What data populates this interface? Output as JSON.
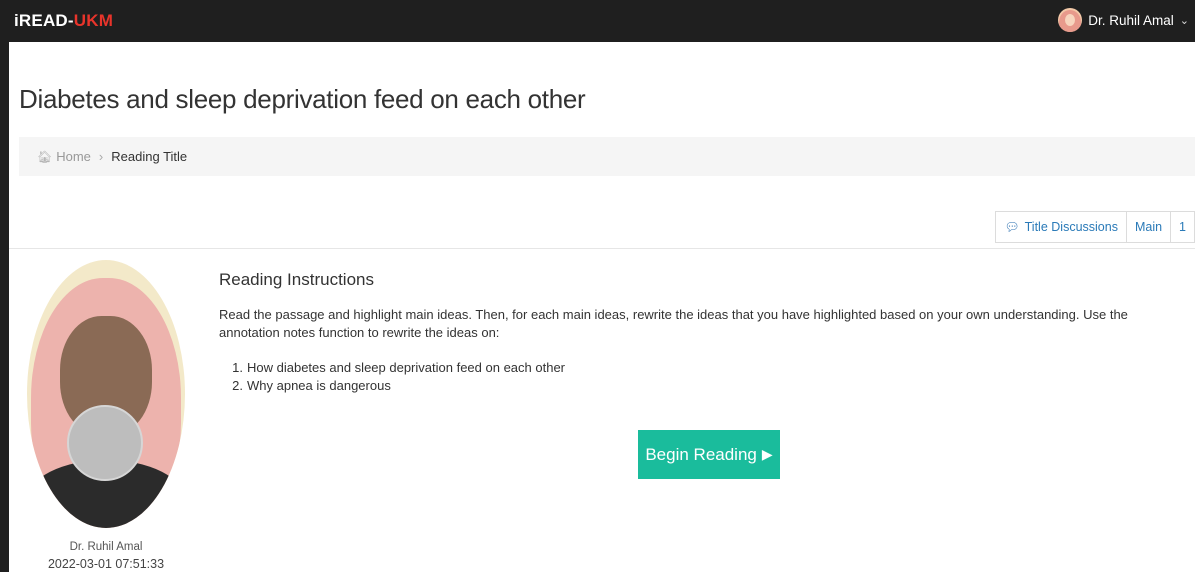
{
  "header": {
    "brand_main": "iREAD-",
    "brand_accent": "UKM",
    "user_name": "Dr. Ruhil Amal"
  },
  "page": {
    "title": "Diabetes and sleep deprivation feed on each other"
  },
  "breadcrumb": {
    "home": "Home",
    "current": "Reading Title"
  },
  "tabs": {
    "discussions": "Title Discussions",
    "main": "Main",
    "page": "1"
  },
  "profile": {
    "name": "Dr. Ruhil Amal",
    "timestamp": "2022-03-01 07:51:33"
  },
  "instructions": {
    "heading": "Reading Instructions",
    "text": "Read the passage and highlight main ideas. Then, for each main ideas, rewrite the ideas that you have highlighted based on your own understanding. Use the annotation notes function to rewrite the ideas on:",
    "items": [
      {
        "num": "1.",
        "text": "How diabetes and sleep deprivation feed on each other"
      },
      {
        "num": "2.",
        "text": "Why apnea is dangerous"
      }
    ]
  },
  "actions": {
    "begin_label": "Begin Reading"
  },
  "colors": {
    "accent": "#1abc9c",
    "brand_red": "#e8342b",
    "topbar": "#1f1f1f",
    "link": "#2a7ab8"
  },
  "icons": [
    "home-icon",
    "chat-icon",
    "play-icon",
    "chevron-down-icon"
  ]
}
